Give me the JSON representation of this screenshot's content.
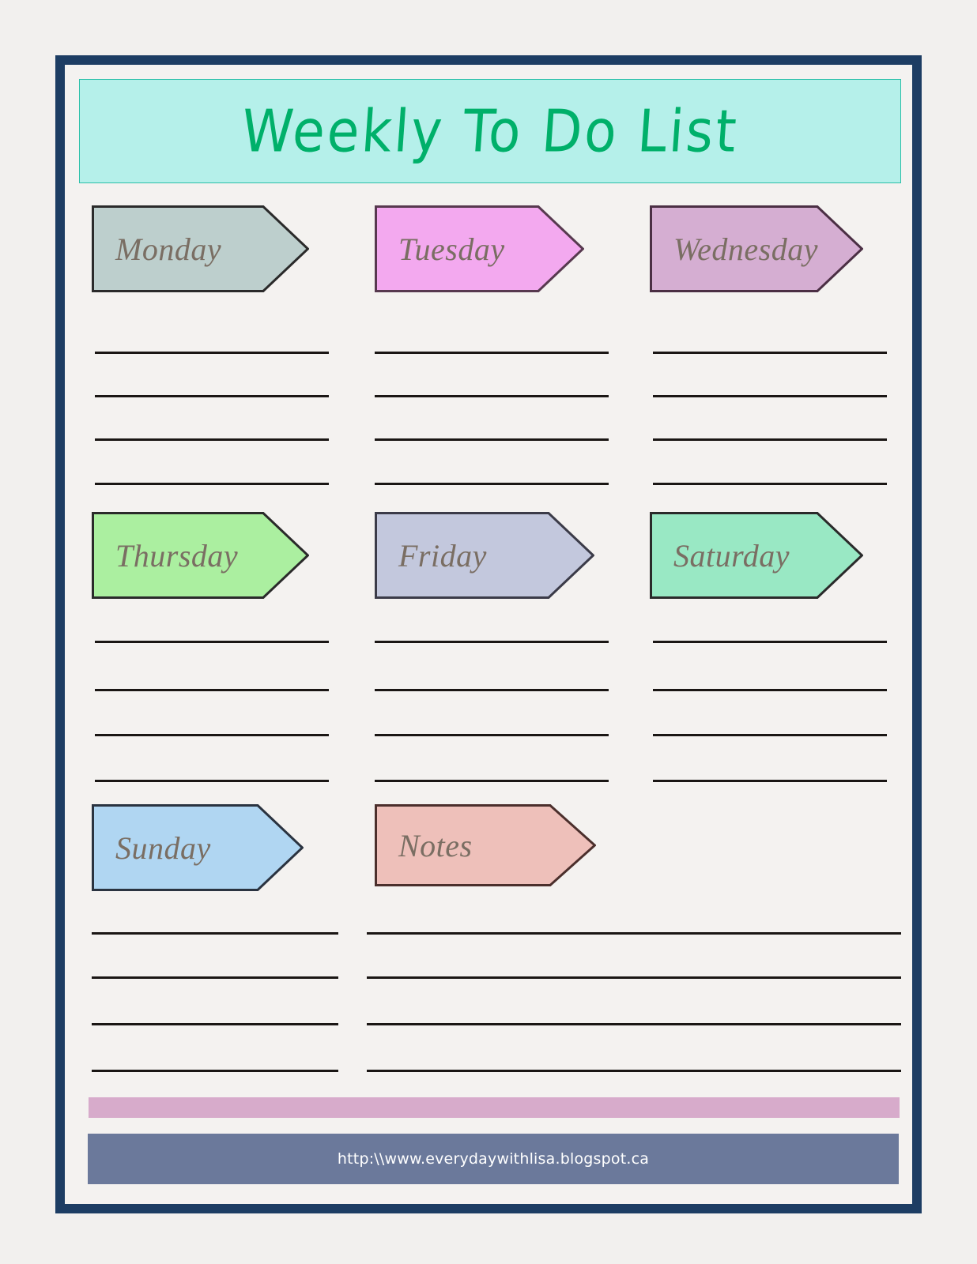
{
  "document": {
    "title": "Weekly To Do List",
    "page_background": "#f2f0ee",
    "sheet_background": "#f4f2f0",
    "frame_color": "#1d3d63"
  },
  "banner": {
    "title": "Weekly To Do List",
    "background": "#b5f0ea",
    "border_color": "#2bbfa8",
    "text_color": "#00b06a"
  },
  "sections": [
    {
      "label": "Monday",
      "fill": "#bdcfcd",
      "stroke": "#2a2a2a",
      "text_color": "#6f675c",
      "lines": 4
    },
    {
      "label": "Tuesday",
      "fill": "#f3a9ef",
      "stroke": "#57394f",
      "text_color": "#7b6b68",
      "lines": 4
    },
    {
      "label": "Wednesday",
      "fill": "#d5aed2",
      "stroke": "#4b2f44",
      "text_color": "#7b6a63",
      "lines": 4
    },
    {
      "label": "Thursday",
      "fill": "#abefa0",
      "stroke": "#2a2a2a",
      "text_color": "#6e6b52",
      "lines": 4
    },
    {
      "label": "Friday",
      "fill": "#c3c8dd",
      "stroke": "#3b3b48",
      "text_color": "#6f6f6d",
      "lines": 4
    },
    {
      "label": "Saturday",
      "fill": "#99e8c4",
      "stroke": "#2a2a2a",
      "text_color": "#6e6a5c",
      "lines": 4
    },
    {
      "label": "Sunday",
      "fill": "#b0d6f2",
      "stroke": "#2a3340",
      "text_color": "#6f6f70",
      "lines": 4
    },
    {
      "label": "Notes",
      "fill": "#eec0ba",
      "stroke": "#4b2f2c",
      "text_color": "#7c6a62",
      "lines": 4
    }
  ],
  "footer": {
    "accent_bar_color": "#d7abcb",
    "url_bar_color": "#6b799b",
    "url": "http:\\\\www.everydaywithlisa.blogspot.ca",
    "url_text_color": "#ffffff"
  }
}
